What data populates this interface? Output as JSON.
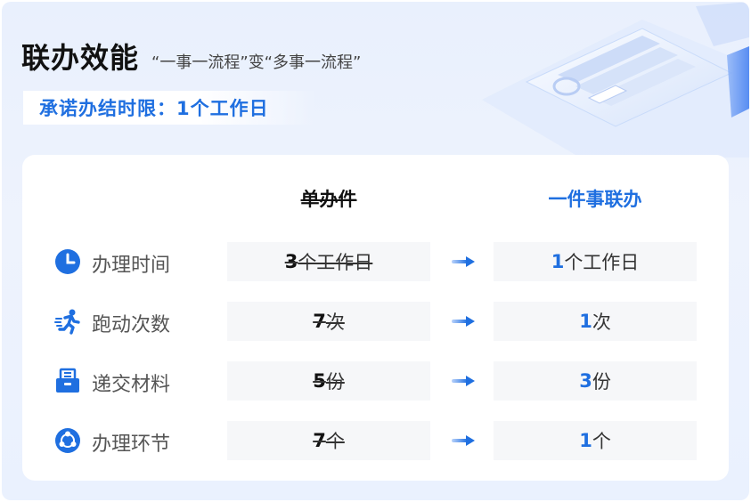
{
  "header": {
    "title": "联办效能",
    "subtitle": "“一事一流程”变“多事一流程”",
    "promise": "承诺办结时限：1个工作日"
  },
  "table": {
    "col_old": "单办件",
    "col_new": "一件事联办",
    "rows": [
      {
        "label": "办理时间",
        "icon": "clock-icon",
        "old_num": "3",
        "old_unit": "个工作日",
        "new_num": "1",
        "new_unit": "个工作日"
      },
      {
        "label": "跑动次数",
        "icon": "running-person-icon",
        "old_num": "7",
        "old_unit": "次",
        "new_num": "1",
        "new_unit": "次"
      },
      {
        "label": "递交材料",
        "icon": "document-box-icon",
        "old_num": "5",
        "old_unit": "份",
        "new_num": "3",
        "new_unit": "份"
      },
      {
        "label": "办理环节",
        "icon": "process-cycle-icon",
        "old_num": "7",
        "old_unit": "个",
        "new_num": "1",
        "new_unit": "个"
      }
    ]
  },
  "colors": {
    "accent": "#1f6fe0",
    "background": "#eaf1fe"
  }
}
